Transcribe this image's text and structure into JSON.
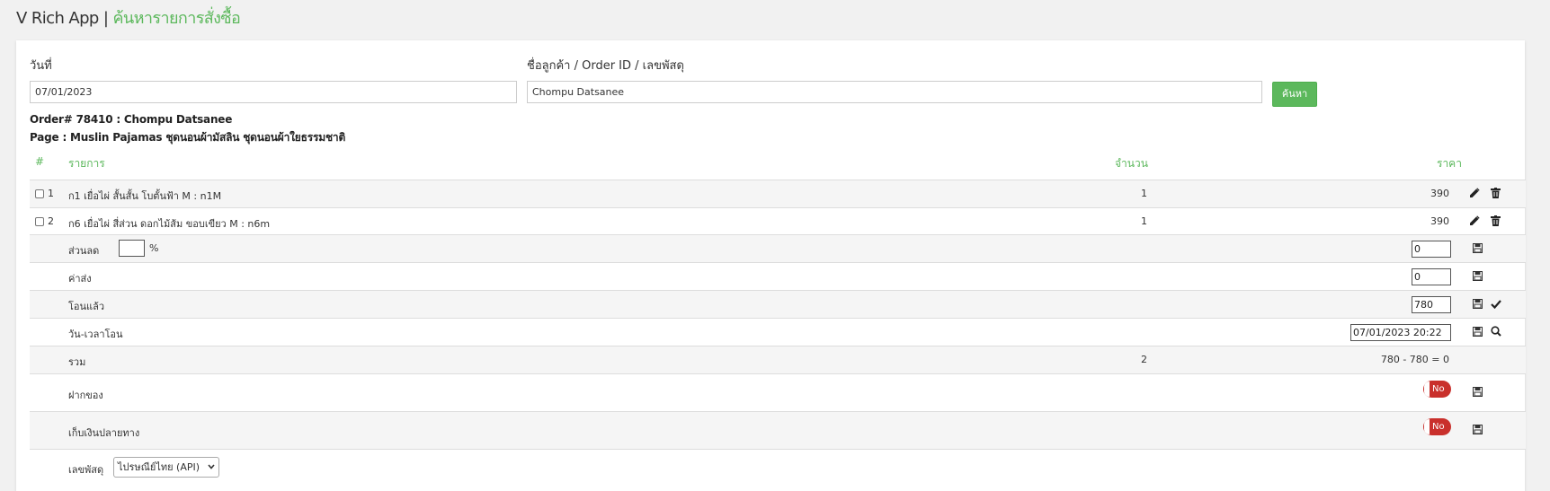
{
  "header": {
    "app_name": "V Rich App",
    "separator": "|",
    "page_title": "ค้นหารายการสั่งซื้อ"
  },
  "search": {
    "date_label": "วันที่",
    "date_value": "07/01/2023",
    "query_label": "ชื่อลูกค้า / Order ID / เลขพัสดุ",
    "query_value": "Chompu Datsanee",
    "button_label": "ค้นหา"
  },
  "order": {
    "title": "Order# 78410 : Chompu Datsanee",
    "page": "Page : Muslin Pajamas ชุดนอนผ้ามัสลิน ชุดนอนผ้าใยธรรมชาติ"
  },
  "table": {
    "columns": {
      "num": "#",
      "item": "รายการ",
      "qty": "จำนวน",
      "price": "ราคา"
    },
    "items": [
      {
        "num": "1",
        "name": "ก1 เยื่อไผ่ สั้นสั้น โบตั้นฟ้า M : n1M",
        "qty": "1",
        "price": "390"
      },
      {
        "num": "2",
        "name": "ก6 เยื่อไผ่ สี่ส่วน ดอกไม้ส้ม ขอบเขียว M : n6m",
        "qty": "1",
        "price": "390"
      }
    ],
    "discount": {
      "label": "ส่วนลด",
      "percent_value": "",
      "percent_sign": "%",
      "amount": "0"
    },
    "shipping": {
      "label": "ค่าส่ง",
      "amount": "0"
    },
    "transferred": {
      "label": "โอนแล้ว",
      "amount": "780"
    },
    "transfer_time": {
      "label": "วัน-เวลาโอน",
      "value": "07/01/2023 20:22"
    },
    "total": {
      "label": "รวม",
      "qty": "2",
      "value": "780 - 780 = 0"
    },
    "deposit": {
      "label": "ฝากของ",
      "toggle": "No"
    },
    "cod": {
      "label": "เก็บเงินปลายทาง",
      "toggle": "No"
    },
    "tracking": {
      "label": "เลขพัสดุ",
      "carrier": "ไปรษณีย์ไทย (API)"
    }
  },
  "colors": {
    "accent_green": "#5cb85c",
    "toggle_red": "#c9302c"
  }
}
